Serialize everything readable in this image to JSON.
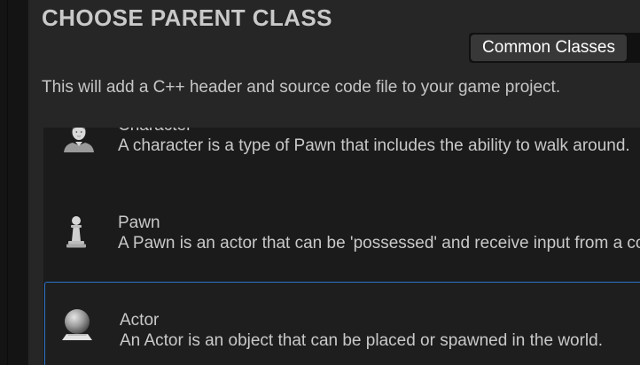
{
  "dialog": {
    "title": "CHOOSE PARENT CLASS",
    "view_toggle_label": "Common Classes",
    "description": "This will add a C++ header and source code file to your game project."
  },
  "class_list": {
    "items": [
      {
        "name": "Character",
        "description": "A character is a type of Pawn that includes the ability to walk around.",
        "icon": "character-icon",
        "selected": false
      },
      {
        "name": "Pawn",
        "description": "A Pawn is an actor that can be 'possessed' and receive input from a controller.",
        "icon": "pawn-icon",
        "selected": false
      },
      {
        "name": "Actor",
        "description": "An Actor is an object that can be placed or spawned in the world.",
        "icon": "actor-icon",
        "selected": true
      }
    ]
  },
  "colors": {
    "selection_border": "#2a74c8",
    "panel_background": "#262626",
    "list_background": "#1b1b1b"
  }
}
